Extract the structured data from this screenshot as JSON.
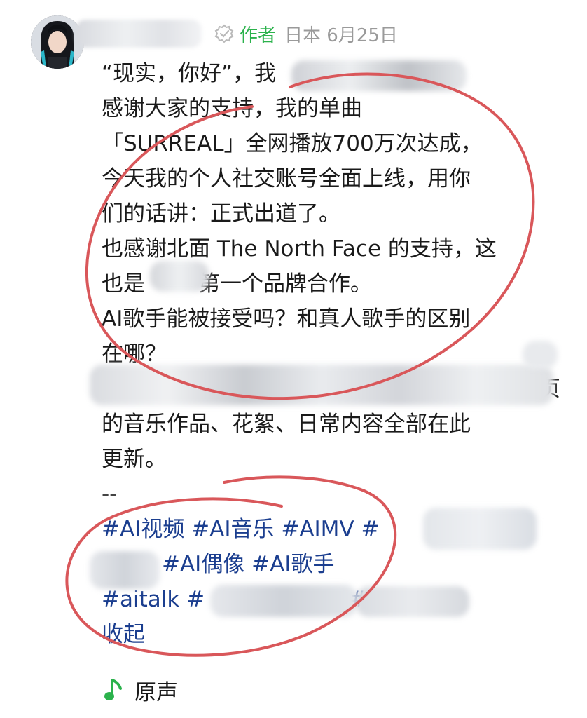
{
  "header": {
    "author_tag": "作者",
    "meta": "日本 6月25日"
  },
  "post": {
    "lines": [
      "“现实，你好”，我",
      "感谢大家的支持，我的单曲",
      "「SURREAL」全网播放700万次达成，",
      "今天我的个人社交账号全面上线，用你",
      "们的话讲：正式出道了。",
      "也感谢北面 The North Face 的支持，这",
      "也是",
      "AI歌手能被接受吗？和真人歌手的区别",
      "在哪？",
      "",
      "的音乐作品、花絮、日常内容全部在此",
      "更新。",
      "--"
    ],
    "line7_suffix": "第一个品牌合作。",
    "line10_tail": "页"
  },
  "hashtags": {
    "row1": "#AI视频 #AI音乐 #AIMV #",
    "row1_end": "#",
    "row2": "#AI偶像 #AI歌手",
    "row3_a": "#aitalk #",
    "row3_b": "#",
    "collapse": "收起"
  },
  "sound": {
    "icon": "music-note-icon",
    "label": "原声"
  },
  "colors": {
    "accent_green": "#2bb24c",
    "hashtag_blue": "#1b3e8f",
    "annotation_red": "#d9575a",
    "meta_gray": "#9a9a9a"
  }
}
